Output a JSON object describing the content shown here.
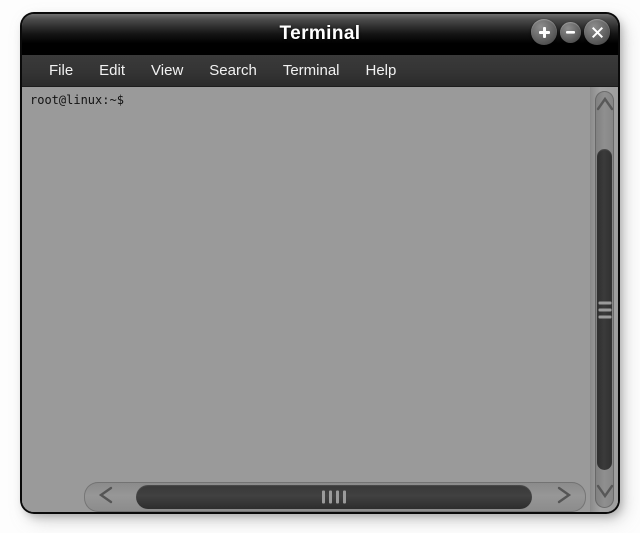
{
  "window": {
    "title": "Terminal",
    "controls": [
      {
        "name": "maximize-button",
        "icon": "plus-icon",
        "label": "+"
      },
      {
        "name": "minimize-button",
        "icon": "minus-icon",
        "label": "−"
      },
      {
        "name": "close-button",
        "icon": "close-icon",
        "label": "×"
      }
    ]
  },
  "menubar": {
    "items": [
      {
        "label": "File"
      },
      {
        "label": "Edit"
      },
      {
        "label": "View"
      },
      {
        "label": "Search"
      },
      {
        "label": "Terminal"
      },
      {
        "label": "Help"
      }
    ]
  },
  "terminal": {
    "prompt": "root@linux:~$",
    "user": "root",
    "host": "linux",
    "cwd": "~",
    "symbol": "$",
    "lines": [
      "root@linux:~$"
    ],
    "background_color": "#9a9a9a",
    "text_color": "#131313"
  },
  "scrollbars": {
    "vertical": {
      "up_icon": "chevron-up-icon",
      "down_icon": "chevron-down-icon",
      "grip_icon": "grip-horizontal-icon",
      "grip_lines": 3
    },
    "horizontal": {
      "left_icon": "chevron-left-icon",
      "right_icon": "chevron-right-icon",
      "grip_icon": "grip-vertical-icon",
      "grip_lines": 4
    }
  },
  "colors": {
    "titlebar": "#000000",
    "menubar": "#333333",
    "frame": "#9a9a9a",
    "desktop": "#fdfdfd",
    "accent": "#ffffff"
  }
}
